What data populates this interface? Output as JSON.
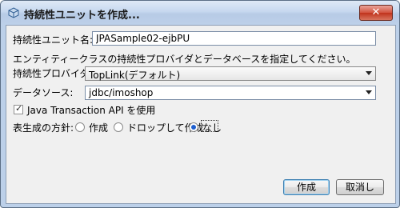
{
  "window": {
    "title": "持続性ユニットを作成...",
    "close_label": "✕"
  },
  "form": {
    "unit_name_label": "持続性ユニット名:",
    "unit_name_value": "JPASample02-ejbPU",
    "description": "エンティティークラスの持続性プロバイダとデータベースを指定してください。",
    "provider_label": "持続性プロバイダ:",
    "provider_value": "TopLink(デフォルト)",
    "datasource_label": "データソース:",
    "datasource_value": "jdbc/imoshop",
    "jta_label": "Java Transaction API を使用",
    "jta_checked": true,
    "table_strategy_label": "表生成の方針:",
    "strategy_options": [
      {
        "label": "作成",
        "selected": false
      },
      {
        "label": "ドロップして作成",
        "selected": false
      },
      {
        "label": "なし",
        "selected": true
      }
    ]
  },
  "buttons": {
    "create_label": "作成",
    "cancel_label": "取消し"
  }
}
